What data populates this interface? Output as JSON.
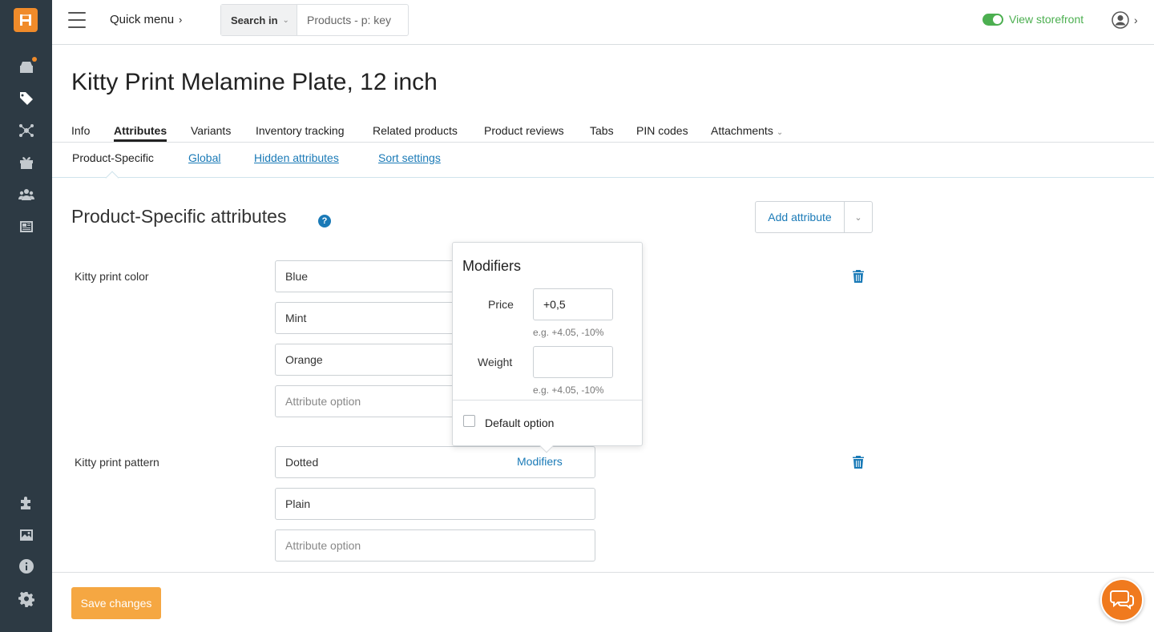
{
  "header": {
    "quick_menu": "Quick menu",
    "search_scope": "Search in",
    "search_placeholder": "Products - p: key",
    "storefront_label": "View storefront"
  },
  "product": {
    "title": "Kitty Print Melamine Plate, 12 inch"
  },
  "tabs": [
    {
      "label": "Info"
    },
    {
      "label": "Attributes",
      "active": true
    },
    {
      "label": "Variants"
    },
    {
      "label": "Inventory tracking"
    },
    {
      "label": "Related products"
    },
    {
      "label": "Product reviews"
    },
    {
      "label": "Tabs"
    },
    {
      "label": "PIN codes"
    },
    {
      "label": "Attachments"
    }
  ],
  "subtabs": [
    {
      "label": "Product-Specific",
      "active": true
    },
    {
      "label": "Global"
    },
    {
      "label": "Hidden attributes"
    },
    {
      "label": "Sort settings"
    }
  ],
  "section": {
    "title": "Product-Specific attributes",
    "help": "?",
    "add_button": "Add attribute"
  },
  "attributes": [
    {
      "name": "Kitty print color",
      "options": [
        "Blue",
        "Mint",
        "Orange"
      ],
      "new_option_placeholder": "Attribute option"
    },
    {
      "name": "Kitty print pattern",
      "options": [
        "Dotted",
        "Plain"
      ],
      "modifiers_link": "Modifiers",
      "new_option_placeholder": "Attribute option"
    }
  ],
  "popover": {
    "title": "Modifiers",
    "price_label": "Price",
    "price_value": "+0,5",
    "price_hint": "e.g. +4.05, -10%",
    "weight_label": "Weight",
    "weight_value": "",
    "weight_hint": "e.g. +4.05, -10%",
    "default_option_label": "Default option",
    "default_option_checked": false
  },
  "footer": {
    "save_label": "Save changes"
  },
  "colors": {
    "sidebar": "#2d3a44",
    "brand": "#f08b2a",
    "link": "#1a7ab7",
    "save_button": "#f5a742",
    "storefront": "#4caf50"
  },
  "icons": {
    "sidebar": [
      "orders-icon",
      "products-icon",
      "marketing-icon",
      "promotions-icon",
      "customers-icon",
      "website-icon",
      "addons-icon",
      "design-icon",
      "info-icon",
      "settings-icon"
    ]
  }
}
